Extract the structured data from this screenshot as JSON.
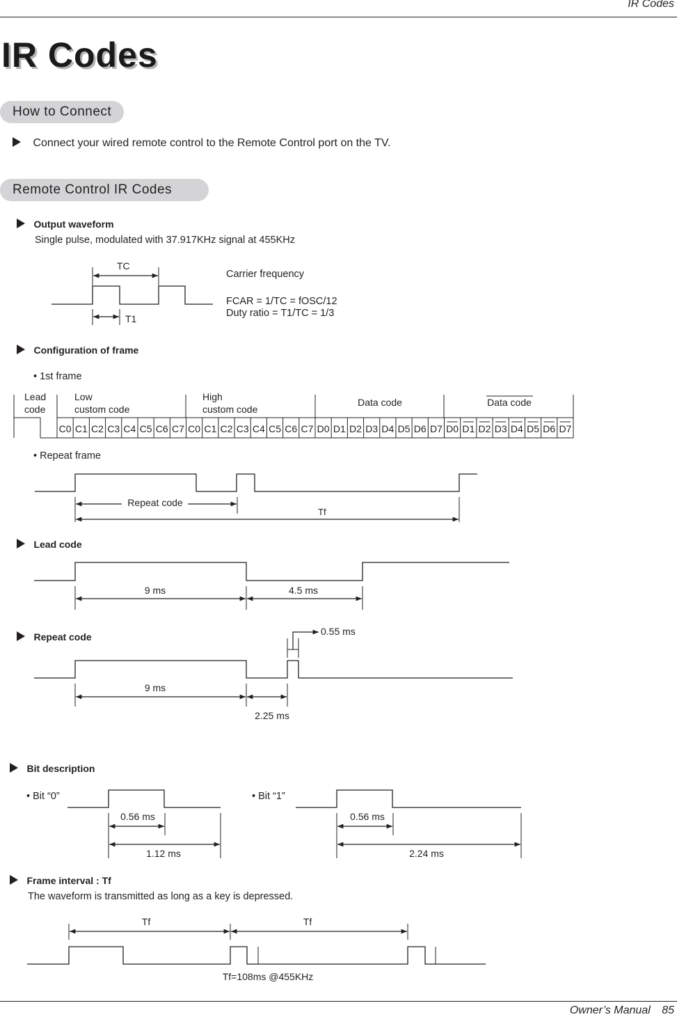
{
  "header": {
    "running_title": "IR Codes"
  },
  "page_title": "IR Codes",
  "how_to_connect": {
    "heading": "How to Connect",
    "instruction": "Connect your wired remote control to the Remote Control port on the TV."
  },
  "remote_codes": {
    "heading": "Remote Control IR Codes",
    "output_waveform": {
      "label": "Output waveform",
      "description": "Single pulse, modulated with 37.917KHz signal at 455KHz",
      "tc_label": "TC",
      "t1_label": "T1",
      "carrier_title": "Carrier frequency",
      "fcar_formula": "FCAR = 1/TC = fOSC/12",
      "duty_ratio": "Duty ratio = T1/TC = 1/3"
    },
    "frame_config": {
      "label": "Configuration of frame",
      "first_frame_label": "1st frame",
      "groups": [
        {
          "line1": "Lead",
          "line2": "code"
        },
        {
          "line1": "Low",
          "line2": "custom code"
        },
        {
          "line1": "High",
          "line2": "custom code"
        },
        {
          "line1": "Data code",
          "line2": ""
        },
        {
          "line1": "Data code",
          "line2": "",
          "overline": true
        }
      ],
      "low_custom_bits": [
        "C0",
        "C1",
        "C2",
        "C3",
        "C4",
        "C5",
        "C6",
        "C7"
      ],
      "high_custom_bits": [
        "C0",
        "C1",
        "C2",
        "C3",
        "C4",
        "C5",
        "C6",
        "C7"
      ],
      "data_bits": [
        "D0",
        "D1",
        "D2",
        "D3",
        "D4",
        "D5",
        "D6",
        "D7"
      ],
      "inverted_data_bits": [
        "D0",
        "D1",
        "D2",
        "D3",
        "D4",
        "D5",
        "D6",
        "D7"
      ],
      "repeat_frame_label": "Repeat frame",
      "repeat_code_label": "Repeat code",
      "tf_label": "Tf"
    },
    "lead_code": {
      "label": "Lead code",
      "high_duration": "9 ms",
      "low_duration": "4.5 ms"
    },
    "repeat_code": {
      "label": "Repeat code",
      "high_duration": "9 ms",
      "low_duration": "2.25 ms",
      "pulse_duration": "0.55 ms"
    },
    "bit_description": {
      "label": "Bit description",
      "bit0": {
        "label": "Bit “0”",
        "pulse": "0.56 ms",
        "period": "1.12 ms"
      },
      "bit1": {
        "label": "Bit “1”",
        "pulse": "0.56 ms",
        "period": "2.24 ms"
      }
    },
    "frame_interval": {
      "label": "Frame interval : Tf",
      "description": "The waveform is transmitted as long as a key is depressed.",
      "tf1_label": "Tf",
      "tf2_label": "Tf",
      "note": "Tf=108ms @455KHz"
    }
  },
  "footer": {
    "manual_label": "Owner’s Manual",
    "page_number": "85"
  }
}
